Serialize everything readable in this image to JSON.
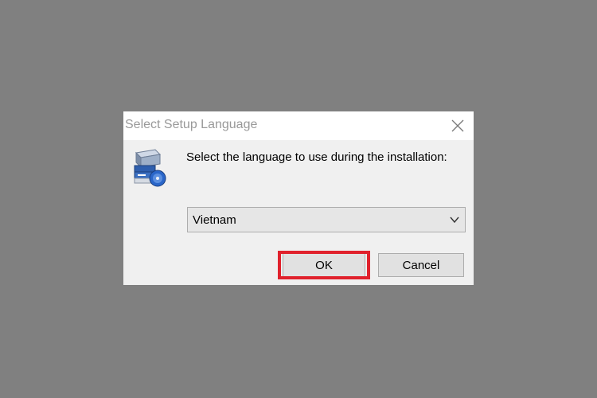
{
  "dialog": {
    "title": "Select Setup Language",
    "prompt": "Select the language to use during the installation:",
    "language_select": {
      "selected": "Vietnam"
    },
    "buttons": {
      "ok_label": "OK",
      "cancel_label": "Cancel"
    }
  },
  "icons": {
    "close": "close-icon",
    "setup": "setup-computer-icon",
    "dropdown": "chevron-down-icon"
  },
  "colors": {
    "background": "#808080",
    "dialog_body": "#f0f0f0",
    "titlebar": "#ffffff",
    "title_text": "#999999",
    "highlight": "#e0212c",
    "button_face": "#e1e1e1"
  }
}
